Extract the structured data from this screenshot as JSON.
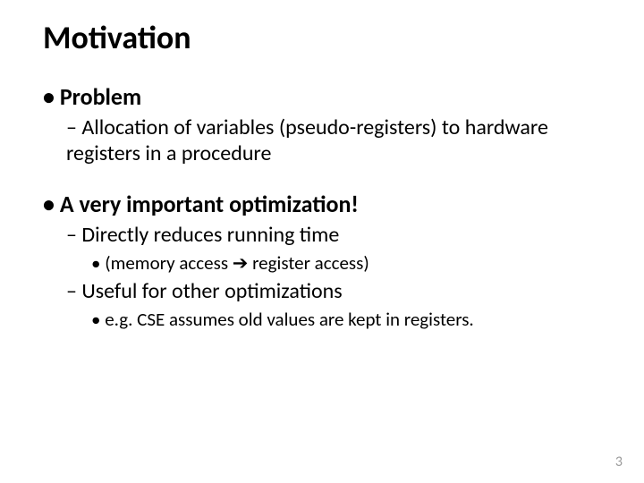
{
  "title": "Motivation",
  "bullets": {
    "problem": {
      "label": "Problem",
      "sub": "Allocation of variables (pseudo-registers) to hardware registers in a procedure"
    },
    "optimization": {
      "label": "A very important optimization!",
      "sub1": "Directly reduces running time",
      "sub1_note_pre": "(memory access ",
      "sub1_note_arrow": "➔",
      "sub1_note_post": " register access)",
      "sub2": "Useful for other optimizations",
      "sub2_note": "e.g. CSE assumes old values are kept in registers."
    }
  },
  "page_number": "3"
}
